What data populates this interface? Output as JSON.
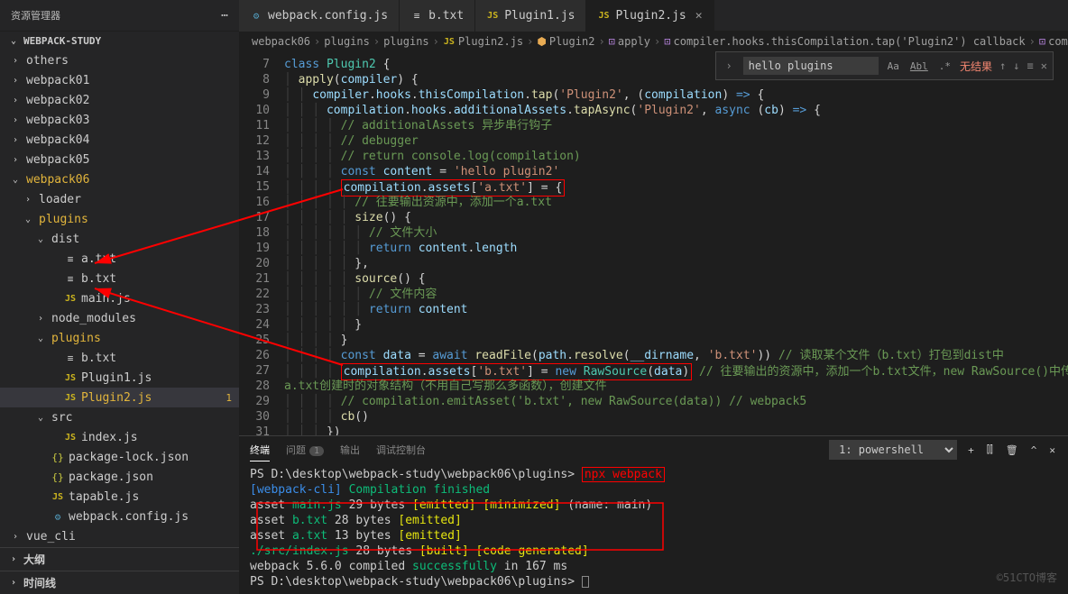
{
  "titlebar": {
    "title": "资源管理器"
  },
  "tabs": [
    {
      "icon": "gear",
      "label": "webpack.config.js",
      "active": false
    },
    {
      "icon": "txt",
      "label": "b.txt",
      "active": false
    },
    {
      "icon": "js",
      "label": "Plugin1.js",
      "active": false
    },
    {
      "icon": "js",
      "label": "Plugin2.js",
      "active": true
    }
  ],
  "workspace": "WEBPACK-STUDY",
  "tree": [
    {
      "d": 1,
      "chev": ">",
      "ico": "",
      "label": "others"
    },
    {
      "d": 1,
      "chev": ">",
      "ico": "",
      "label": "webpack01"
    },
    {
      "d": 1,
      "chev": ">",
      "ico": "",
      "label": "webpack02"
    },
    {
      "d": 1,
      "chev": ">",
      "ico": "",
      "label": "webpack03"
    },
    {
      "d": 1,
      "chev": ">",
      "ico": "",
      "label": "webpack04"
    },
    {
      "d": 1,
      "chev": ">",
      "ico": "",
      "label": "webpack05"
    },
    {
      "d": 1,
      "chev": "v",
      "ico": "",
      "label": "webpack06",
      "hl": true
    },
    {
      "d": 2,
      "chev": ">",
      "ico": "",
      "label": "loader"
    },
    {
      "d": 2,
      "chev": "v",
      "ico": "",
      "label": "plugins",
      "hl": true
    },
    {
      "d": 3,
      "chev": "v",
      "ico": "",
      "label": "dist"
    },
    {
      "d": 4,
      "chev": "",
      "ico": "txt",
      "label": "a.txt"
    },
    {
      "d": 4,
      "chev": "",
      "ico": "txt",
      "label": "b.txt"
    },
    {
      "d": 4,
      "chev": "",
      "ico": "js",
      "label": "main.js"
    },
    {
      "d": 3,
      "chev": ">",
      "ico": "",
      "label": "node_modules"
    },
    {
      "d": 3,
      "chev": "v",
      "ico": "",
      "label": "plugins",
      "hl": true
    },
    {
      "d": 4,
      "chev": "",
      "ico": "txt",
      "label": "b.txt"
    },
    {
      "d": 4,
      "chev": "",
      "ico": "js",
      "label": "Plugin1.js"
    },
    {
      "d": 4,
      "chev": "",
      "ico": "js",
      "label": "Plugin2.js",
      "active": true,
      "hl": true,
      "mod": "1"
    },
    {
      "d": 3,
      "chev": "v",
      "ico": "",
      "label": "src"
    },
    {
      "d": 4,
      "chev": "",
      "ico": "js",
      "label": "index.js"
    },
    {
      "d": 3,
      "chev": "",
      "ico": "json",
      "label": "package-lock.json"
    },
    {
      "d": 3,
      "chev": "",
      "ico": "json",
      "label": "package.json"
    },
    {
      "d": 3,
      "chev": "",
      "ico": "js",
      "label": "tapable.js"
    },
    {
      "d": 3,
      "chev": "",
      "ico": "gear",
      "label": "webpack.config.js"
    },
    {
      "d": 1,
      "chev": ">",
      "ico": "",
      "label": "vue_cli"
    }
  ],
  "sections": {
    "outline": "大纲",
    "timeline": "时间线"
  },
  "breadcrumb": [
    "webpack06",
    "plugins",
    "plugins",
    "Plugin2.js",
    "Plugin2",
    "apply",
    "compiler.hooks.thisCompilation.tap('Plugin2') callback",
    "compilatio"
  ],
  "find": {
    "value": "hello plugins",
    "opts": [
      "Aa",
      "Abl",
      ".*"
    ],
    "result": "无结果"
  },
  "linestart": 8,
  "code": [
    "<span class='kw'>class</span> <span class='cls'>Plugin2</span> <span class='pn'>{</span>",
    "  <span class='fn'>apply</span><span class='pn'>(</span><span class='var'>compiler</span><span class='pn'>) {</span>",
    "    <span class='var'>compiler</span>.<span class='var'>hooks</span>.<span class='var'>thisCompilation</span>.<span class='fn'>tap</span><span class='pn'>(</span><span class='str'>'Plugin2'</span><span class='pn'>, (</span><span class='var'>compilation</span><span class='pn'>) </span><span class='kw'>=&gt;</span><span class='pn'> {</span>",
    "      <span class='var'>compilation</span>.<span class='var'>hooks</span>.<span class='var'>additionalAssets</span>.<span class='fn'>tapAsync</span><span class='pn'>(</span><span class='str'>'Plugin2'</span><span class='pn'>, </span><span class='kw'>async</span><span class='pn'> (</span><span class='var'>cb</span><span class='pn'>) </span><span class='kw'>=&gt;</span><span class='pn'> {</span>",
    "        <span class='cmt'>// additionalAssets 异步串行钩子</span>",
    "        <span class='cmt'>// debugger</span>",
    "        <span class='cmt'>// return console.log(compilation)</span>",
    "        <span class='kw'>const</span> <span class='var'>content</span> <span class='pn'>=</span> <span class='str'>'hello plugin2'</span>",
    "        <span class='redbox'><span class='var'>compilation</span>.<span class='var'>assets</span><span class='pn'>[</span><span class='str'>'a.txt'</span><span class='pn'>] = {</span></span>",
    "          <span class='cmt'>// 往要输出资源中，添加一个a.txt</span>",
    "          <span class='fn'>size</span><span class='pn'>() {</span>",
    "            <span class='cmt'>// 文件大小</span>",
    "            <span class='kw'>return</span> <span class='var'>content</span>.<span class='var'>length</span>",
    "          <span class='pn'>},</span>",
    "          <span class='fn'>source</span><span class='pn'>() {</span>",
    "            <span class='cmt'>// 文件内容</span>",
    "            <span class='kw'>return</span> <span class='var'>content</span>",
    "          <span class='pn'>}</span>",
    "        <span class='pn'>}</span>",
    "        <span class='kw'>const</span> <span class='var'>data</span> <span class='pn'>=</span> <span class='kw'>await</span> <span class='fn'>readFile</span><span class='pn'>(</span><span class='var'>path</span>.<span class='fn'>resolve</span><span class='pn'>(</span><span class='var'>__dirname</span><span class='pn'>, </span><span class='str'>'b.txt'</span><span class='pn'>))</span> <span class='cmt'>// 读取某个文件（b.txt）打包到dist中</span>",
    "        <span class='redbox'><span class='var'>compilation</span>.<span class='var'>assets</span><span class='pn'>[</span><span class='str'>'b.txt'</span><span class='pn'>] = </span><span class='kw'>new</span> <span class='cls'>RawSource</span><span class='pn'>(</span><span class='var'>data</span><span class='pn'>)</span></span> <span class='cmt'>// 往要输出的资源中，添加一个b.txt文件，new RawSource()中传入数据转为</span>",
    "<span class='cmt'>a.txt创建时的对象结构（不用自己写那么多函数），创建文件</span>",
    "        <span class='cmt'>// compilation.emitAsset('b.txt', new RawSource(data)) // webpack5</span>",
    "        <span class='fn'>cb</span><span class='pn'>()</span>",
    "      <span class='pn'>})</span>"
  ],
  "terminal": {
    "tabs": [
      "终端",
      "问题",
      "输出",
      "调试控制台"
    ],
    "badge": "1",
    "select": "1: powershell",
    "lines": [
      "PS D:\\desktop\\webpack-study\\webpack06\\plugins> <span class='t-red'>npx webpack</span>",
      "<span class='t-cyan'>[webpack-cli]</span> <span class='t-grn'>Compilation finished</span>",
      "asset <span class='t-grn'>main.js</span> 29 bytes <span class='t-yel'>[emitted]</span> <span class='t-yel'>[minimized]</span> (name: main)",
      "asset <span class='t-grn'>b.txt</span> 28 bytes <span class='t-yel'>[emitted]</span>",
      "asset <span class='t-grn'>a.txt</span> 13 bytes <span class='t-yel'>[emitted]</span>",
      "<span class='t-grn'>./src/index.js</span> 28 bytes <span class='t-yel'>[built]</span> <span class='t-yel'>[code generated]</span>",
      "webpack 5.6.0 compiled <span class='t-grn'>successfully</span> in 167 ms",
      "PS D:\\desktop\\webpack-study\\webpack06\\plugins> <span class='cursor-box'></span>"
    ]
  },
  "watermark": "©51CTO博客"
}
